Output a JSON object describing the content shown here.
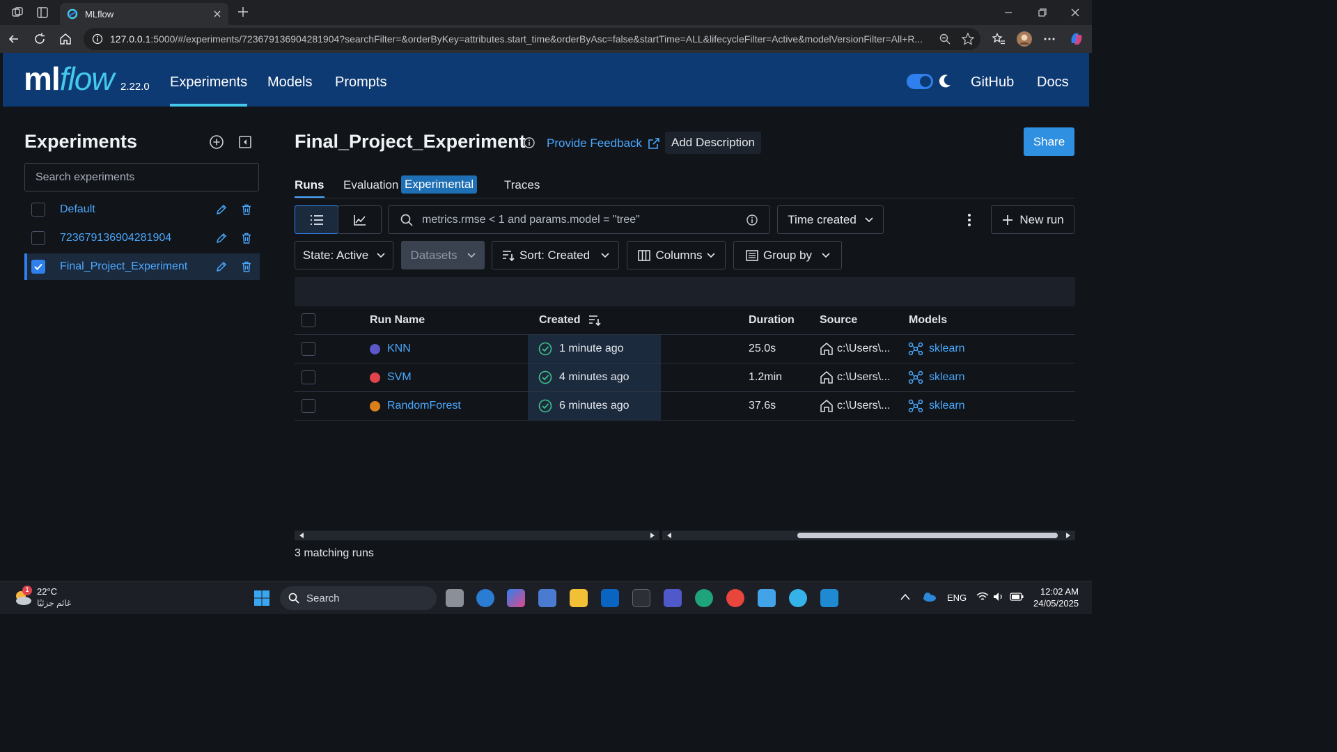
{
  "browser": {
    "tab_title": "MLflow",
    "url_host": "127.0.0.1",
    "url_rest": ":5000/#/experiments/723679136904281904?searchFilter=&orderByKey=attributes.start_time&orderByAsc=false&startTime=ALL&lifecycleFilter=Active&modelVersionFilter=All+R..."
  },
  "header": {
    "logo_main": "ml",
    "logo_italic": "flow",
    "version": "2.22.0",
    "nav": [
      "Experiments",
      "Models",
      "Prompts"
    ],
    "github": "GitHub",
    "docs": "Docs"
  },
  "sidebar": {
    "title": "Experiments",
    "search_placeholder": "Search experiments",
    "experiments": [
      {
        "name": "Default",
        "checked": false
      },
      {
        "name": "723679136904281904",
        "checked": false
      },
      {
        "name": "Final_Project_Experiment",
        "checked": true
      }
    ]
  },
  "main": {
    "title": "Final_Project_Experiment",
    "feedback": "Provide Feedback",
    "add_description": "Add Description",
    "share": "Share",
    "tabs": {
      "runs": "Runs",
      "evaluation": "Evaluation",
      "experimental_badge": "Experimental",
      "traces": "Traces"
    },
    "search_value": "metrics.rmse < 1 and params.model = \"tree\"",
    "time_created": "Time created",
    "new_run": "New run",
    "filters": {
      "state": "State: Active",
      "datasets": "Datasets",
      "sort": "Sort: Created",
      "columns": "Columns",
      "group_by": "Group by"
    },
    "columns": [
      "Run Name",
      "Created",
      "Duration",
      "Source",
      "Models"
    ],
    "runs": [
      {
        "name": "KNN",
        "color": "#5b57c9",
        "created": "1 minute ago",
        "duration": "25.0s",
        "source": "c:\\Users\\...",
        "model": "sklearn"
      },
      {
        "name": "SVM",
        "color": "#e0434c",
        "created": "4 minutes ago",
        "duration": "1.2min",
        "source": "c:\\Users\\...",
        "model": "sklearn"
      },
      {
        "name": "RandomForest",
        "color": "#d9801c",
        "created": "6 minutes ago",
        "duration": "37.6s",
        "source": "c:\\Users\\...",
        "model": "sklearn"
      }
    ],
    "matching": "3 matching runs"
  },
  "taskbar": {
    "temp": "22°C",
    "weather": "غائم جزئيًا",
    "weather_badge": "1",
    "search": "Search",
    "lang": "ENG",
    "time": "12:02 AM",
    "date": "24/05/2025"
  }
}
